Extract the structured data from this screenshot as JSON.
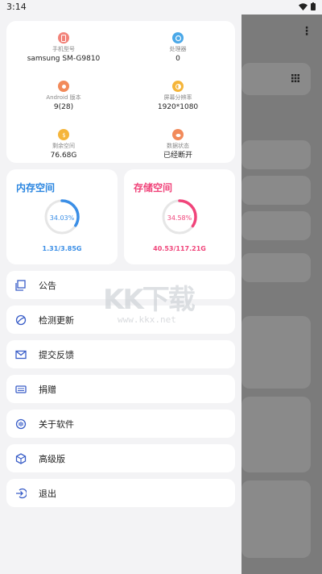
{
  "statusbar": {
    "time": "3:14"
  },
  "device_info": [
    {
      "label": "手机型号",
      "value": "samsung SM-G9810",
      "icon": "phone-icon",
      "color": "#f2837a"
    },
    {
      "label": "处理器",
      "value": "0",
      "icon": "cpu-icon",
      "color": "#4aa8e8"
    },
    {
      "label": "Android 版本",
      "value": "9(28)",
      "icon": "android-icon",
      "color": "#f28a5a"
    },
    {
      "label": "屏幕分辨率",
      "value": "1920*1080",
      "icon": "screen-icon",
      "color": "#f5b53a"
    },
    {
      "label": "剩余空间",
      "value": "76.68G",
      "icon": "storage-icon",
      "color": "#f5b53a"
    },
    {
      "label": "数据状态",
      "value": "已经断开",
      "icon": "data-icon",
      "color": "#f28a5a"
    }
  ],
  "memory": {
    "title": "内存空间",
    "percent_text": "34.03%",
    "percent": 34.03,
    "usage": "1.31/3.85G",
    "color": "#3a8ee6"
  },
  "storage": {
    "title": "存储空间",
    "percent_text": "34.58%",
    "percent": 34.58,
    "usage": "40.53/117.21G",
    "color": "#f0447a"
  },
  "menu": [
    {
      "label": "公告",
      "icon": "announcement-icon"
    },
    {
      "label": "检测更新",
      "icon": "update-icon"
    },
    {
      "label": "提交反馈",
      "icon": "feedback-icon"
    },
    {
      "label": "捐赠",
      "icon": "donate-icon"
    },
    {
      "label": "关于软件",
      "icon": "about-icon"
    },
    {
      "label": "高级版",
      "icon": "premium-icon"
    },
    {
      "label": "退出",
      "icon": "exit-icon"
    }
  ],
  "watermark": {
    "brand": "KK下载",
    "url": "www.kkx.net"
  }
}
